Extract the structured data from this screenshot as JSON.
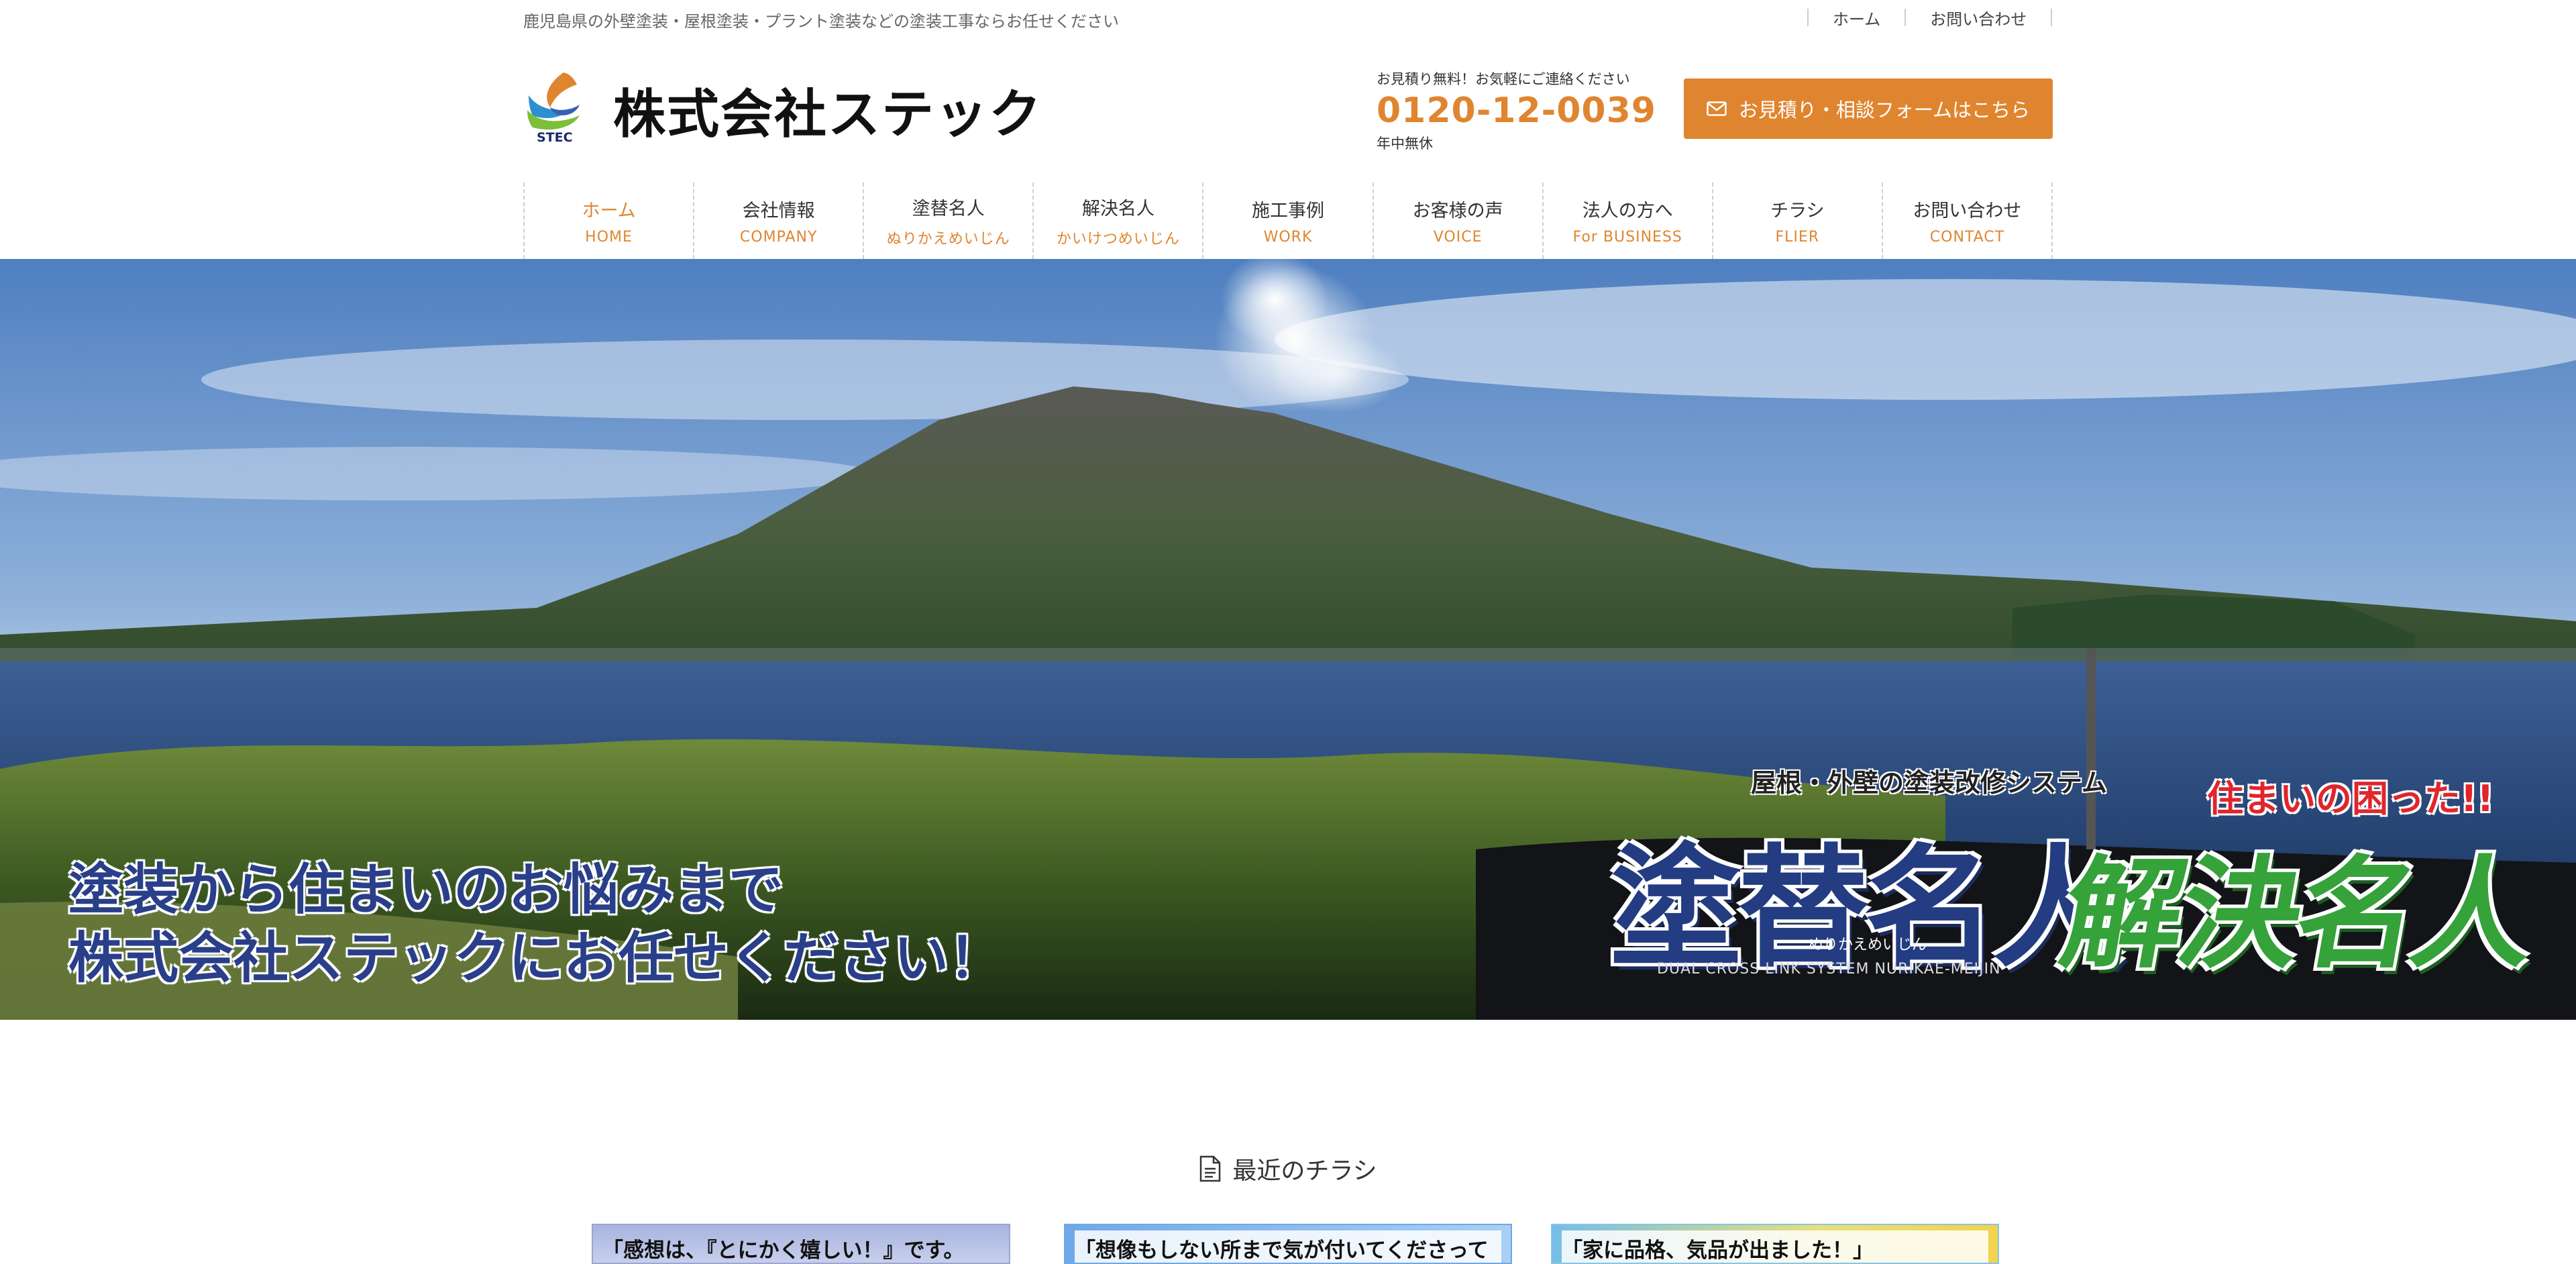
{
  "topbar": {
    "tagline": "鹿児島県の外壁塗装・屋根塗装・プラント塗装などの塗装工事ならお任せください",
    "links": [
      {
        "label": "ホーム"
      },
      {
        "label": "お問い合わせ"
      }
    ]
  },
  "header": {
    "logo": {
      "mark_text": "STEC",
      "name": "株式会社ステック"
    },
    "contact": {
      "free_note": "お見積り無料！お気軽にご連絡ください",
      "tel": "0120-12-0039",
      "hours": "年中無休"
    },
    "cta": {
      "label": "お見積り・相談フォームはこちら",
      "icon": "mail-icon"
    }
  },
  "nav": {
    "items": [
      {
        "jp": "ホーム",
        "en": "HOME",
        "active": true
      },
      {
        "jp": "会社情報",
        "en": "COMPANY"
      },
      {
        "jp": "塗替名人",
        "en": "ぬりかえめいじん"
      },
      {
        "jp": "解決名人",
        "en": "かいけつめいじん"
      },
      {
        "jp": "施工事例",
        "en": "WORK"
      },
      {
        "jp": "お客様の声",
        "en": "VOICE"
      },
      {
        "jp": "法人の方へ",
        "en": "For BUSINESS"
      },
      {
        "jp": "チラシ",
        "en": "FLIER"
      },
      {
        "jp": "お問い合わせ",
        "en": "CONTACT"
      }
    ]
  },
  "hero": {
    "caption_line1": "塗装から住まいのお悩みまで",
    "caption_line2": "株式会社ステックにお任せください！",
    "nuri": {
      "sub": "屋根・外壁の塗装改修システム",
      "title": "塗替名人",
      "ruby": "ぬりかえめいじん",
      "en": "DUAL CROSS LINK SYSTEM NURIKAE-MEIJIN"
    },
    "kai": {
      "sub": "住まいの困った!!",
      "title": "解決名人"
    }
  },
  "fliers": {
    "title": "最近のチラシ",
    "icon": "document-icon",
    "items": [
      {
        "headline": "「感想は、『とにかく嬉しい！』です。"
      },
      {
        "headline": "「想像もしない所まで気が付いてくださって"
      },
      {
        "headline": "「家に品格、気品が出ました！」"
      }
    ]
  },
  "colors": {
    "accent": "#e0852f",
    "navy": "#233c82",
    "green": "#35a23a"
  }
}
